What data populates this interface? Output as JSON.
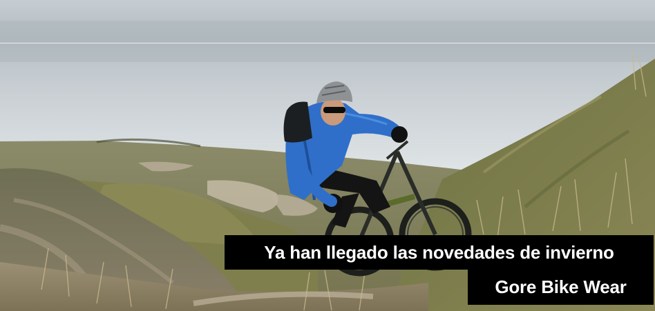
{
  "banner": {
    "headline": "Ya han llegado las novedades de invierno",
    "brand": "Gore Bike Wear"
  },
  "colors": {
    "caption_bg": "#000000",
    "caption_text": "#ffffff",
    "jacket": "#2f6fc9",
    "sky": "#d3dadd",
    "grass": "#6f7446"
  },
  "image": {
    "subject": "mountain-biker-photo"
  }
}
